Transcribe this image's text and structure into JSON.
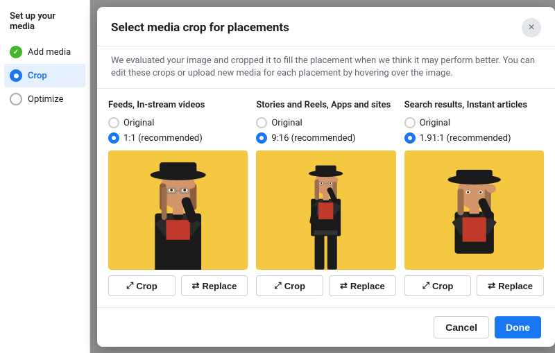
{
  "sidebar": {
    "title": "Set up your media",
    "items": [
      {
        "id": "add-media",
        "label": "Add media",
        "state": "done"
      },
      {
        "id": "crop",
        "label": "Crop",
        "state": "active"
      },
      {
        "id": "optimize",
        "label": "Optimize",
        "state": "pending"
      }
    ]
  },
  "modal": {
    "title": "Select media crop for placements",
    "description": "We evaluated your image and cropped it to fill the placement when we think it may perform better. You can edit these crops or upload new media for each placement by hovering over the image.",
    "close_label": "×",
    "columns": [
      {
        "id": "feeds",
        "title": "Feeds, In-stream videos",
        "options": [
          {
            "label": "Original",
            "selected": false
          },
          {
            "label": "1:1 (recommended)",
            "selected": true
          }
        ],
        "aspect": "1:1"
      },
      {
        "id": "stories",
        "title": "Stories and Reels, Apps and sites",
        "options": [
          {
            "label": "Original",
            "selected": false
          },
          {
            "label": "9:16 (recommended)",
            "selected": true
          }
        ],
        "aspect": "9:16"
      },
      {
        "id": "search",
        "title": "Search results, Instant articles",
        "options": [
          {
            "label": "Original",
            "selected": false
          },
          {
            "label": "1.91:1 (recommended)",
            "selected": true
          }
        ],
        "aspect": "1.91:1"
      }
    ],
    "buttons": {
      "crop": "Crop",
      "replace": "Replace",
      "cancel": "Cancel",
      "done": "Done"
    }
  }
}
